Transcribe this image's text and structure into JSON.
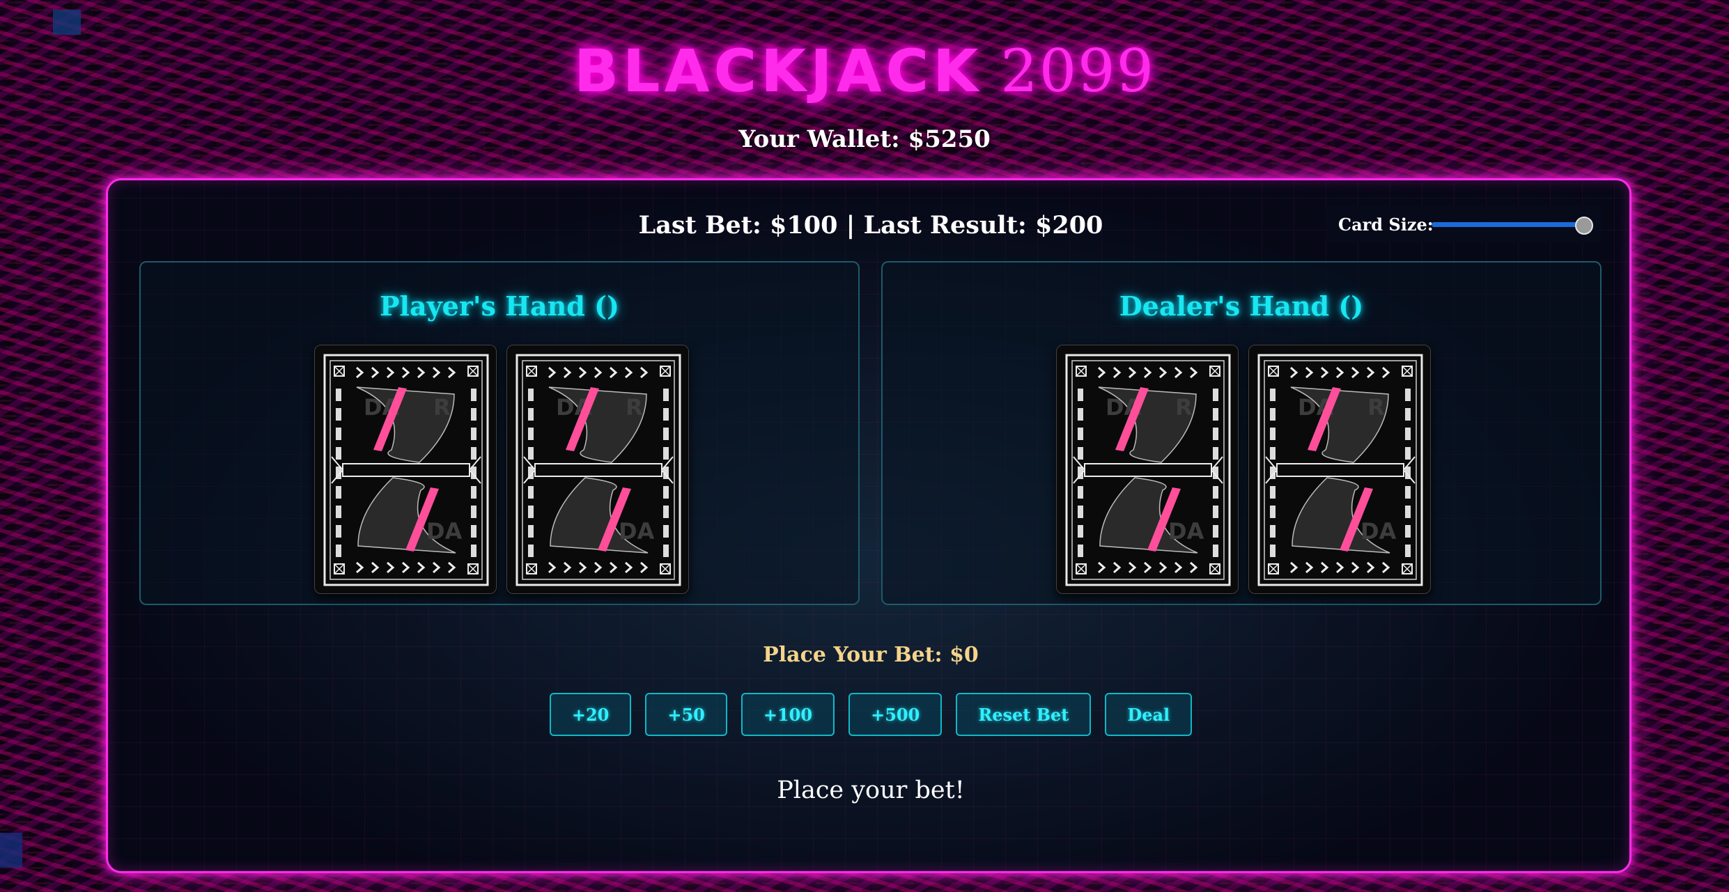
{
  "header": {
    "title_word1": "BLACKJACK",
    "title_word2": "2099",
    "wallet": "Your Wallet: $5250"
  },
  "info": {
    "last_bet_result": "Last Bet: $100 | Last Result: $200"
  },
  "card_size": {
    "label": "Card Size:",
    "value_fraction": 1.0
  },
  "player_hand": {
    "title": "Player's Hand ()",
    "cards": [
      {
        "face": "back"
      },
      {
        "face": "back"
      }
    ]
  },
  "dealer_hand": {
    "title": "Dealer's Hand ()",
    "cards": [
      {
        "face": "back"
      },
      {
        "face": "back"
      }
    ]
  },
  "bet": {
    "title": "Place Your Bet: $0",
    "buttons": [
      "+20",
      "+50",
      "+100",
      "+500",
      "Reset Bet",
      "Deal"
    ]
  },
  "status_message": "Place your bet!",
  "colors": {
    "neon_pink": "#ff2bea",
    "neon_cyan": "#19e6f0",
    "bet_gold": "#f5d48a",
    "slider_blue": "#1a6cd6"
  }
}
